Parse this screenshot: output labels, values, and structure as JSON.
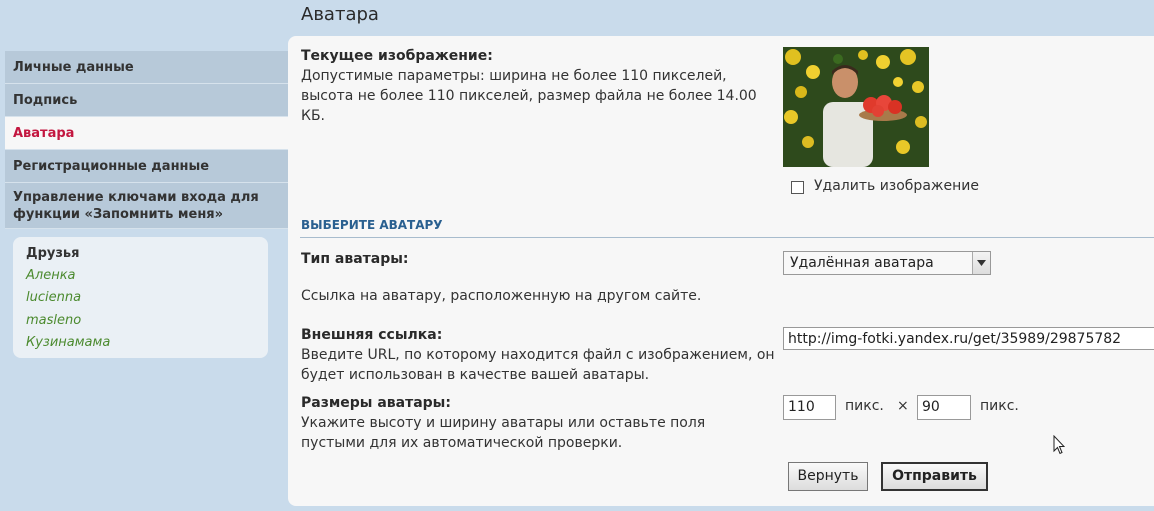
{
  "page": {
    "title": "Аватара"
  },
  "sidebar": {
    "items": [
      {
        "label": "Личные данные"
      },
      {
        "label": "Подпись"
      },
      {
        "label": "Аватара"
      },
      {
        "label": "Регистрационные данные"
      },
      {
        "label": "Управление ключами входа для функции «Запомнить меня»"
      }
    ],
    "friends": {
      "title": "Друзья",
      "names": [
        "Аленка",
        "lucienna",
        "masleno",
        "Кузинамама"
      ]
    }
  },
  "current": {
    "title": "Текущее изображение:",
    "desc": "Допустимые параметры: ширина не более 110 пикселей, высота не более 110 пикселей, размер файла не более 14.00 КБ.",
    "delete_label": "Удалить изображение"
  },
  "choose": {
    "heading": "ВЫБЕРИТЕ АВАТАРУ",
    "type_label": "Тип аватары:",
    "type_value": "Удалённая аватара",
    "type_desc": "Ссылка на аватару, расположенную на другом сайте.",
    "url_label": "Внешняя ссылка:",
    "url_desc": "Введите URL, по которому находится файл с изображением, он будет использован в качестве вашей аватары.",
    "url_value": "http://img-fotki.yandex.ru/get/35989/29875782",
    "size_label": "Размеры аватары:",
    "size_desc": "Укажите высоту и ширину аватары или оставьте поля пустыми для их автоматической проверки.",
    "width_value": "110",
    "height_value": "90",
    "unit": "пикс.",
    "times": "×"
  },
  "buttons": {
    "reset": "Вернуть",
    "submit": "Отправить"
  },
  "colors": {
    "active_nav": "#c3163f",
    "friend_link": "#4b8a2e",
    "section_head": "#2a6090"
  }
}
